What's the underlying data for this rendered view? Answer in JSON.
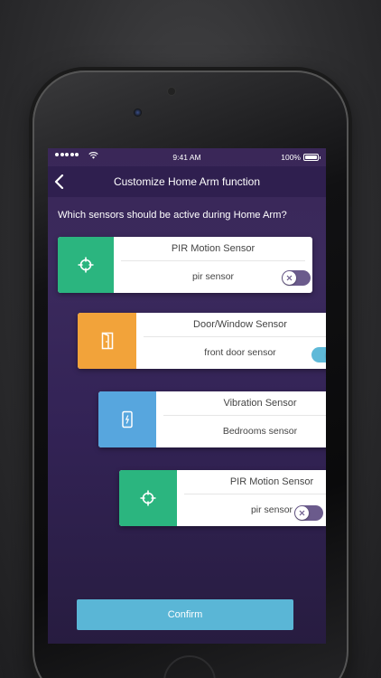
{
  "status_bar": {
    "time": "9:41 AM",
    "battery": "100%"
  },
  "nav": {
    "title": "Customize Home Arm function"
  },
  "question": "Which sensors should be active during Home Arm?",
  "sensors": [
    {
      "title": "PIR Motion Sensor",
      "name": "pir sensor",
      "icon": "crosshair-icon",
      "tile_color": "#2bb57f",
      "active": false
    },
    {
      "title": "Door/Window Sensor",
      "name": "front door sensor",
      "icon": "door-icon",
      "tile_color": "#f2a33a",
      "active": true
    },
    {
      "title": "Vibration Sensor",
      "name": "Bedrooms sensor",
      "icon": "vibration-icon",
      "tile_color": "#57a6de",
      "active": true
    },
    {
      "title": "PIR Motion Sensor",
      "name": "pir sensor",
      "icon": "crosshair-icon",
      "tile_color": "#2bb57f",
      "active": false
    }
  ],
  "confirm_label": "Confirm",
  "colors": {
    "toggle_on": "#5eb9d8",
    "toggle_off": "#6b5b8c",
    "confirm": "#5ab6d6"
  }
}
